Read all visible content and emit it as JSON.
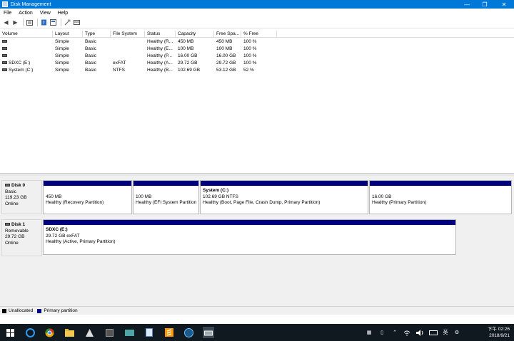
{
  "window": {
    "title": "Disk Management",
    "controls": {
      "minimize": "—",
      "maximize": "❐",
      "close": "✕"
    }
  },
  "menu": [
    "File",
    "Action",
    "View",
    "Help"
  ],
  "toolbar_icons": [
    "back-icon",
    "forward-icon",
    "list-icon",
    "help-icon",
    "properties-icon",
    "connect-icon",
    "disk-view-icon"
  ],
  "volume_table": {
    "columns": [
      "Volume",
      "Layout",
      "Type",
      "File System",
      "Status",
      "Capacity",
      "Free Spa...",
      "% Free"
    ],
    "rows": [
      {
        "volume": "",
        "layout": "Simple",
        "type": "Basic",
        "fs": "",
        "status": "Healthy (R...",
        "capacity": "450 MB",
        "free": "450 MB",
        "pct": "100 %"
      },
      {
        "volume": "",
        "layout": "Simple",
        "type": "Basic",
        "fs": "",
        "status": "Healthy (E...",
        "capacity": "100 MB",
        "free": "100 MB",
        "pct": "100 %"
      },
      {
        "volume": "",
        "layout": "Simple",
        "type": "Basic",
        "fs": "",
        "status": "Healthy (P...",
        "capacity": "16.00 GB",
        "free": "16.00 GB",
        "pct": "100 %"
      },
      {
        "volume": "SDXC (E:)",
        "layout": "Simple",
        "type": "Basic",
        "fs": "exFAT",
        "status": "Healthy (A...",
        "capacity": "29.72 GB",
        "free": "29.72 GB",
        "pct": "100 %"
      },
      {
        "volume": "System (C:)",
        "layout": "Simple",
        "type": "Basic",
        "fs": "NTFS",
        "status": "Healthy (B...",
        "capacity": "102.69 GB",
        "free": "53.12 GB",
        "pct": "52 %"
      }
    ]
  },
  "disks": [
    {
      "name": "Disk 0",
      "type": "Basic",
      "size": "119.23 GB",
      "state": "Online",
      "partitions": [
        {
          "title": "",
          "line1": "450 MB",
          "line2": "Healthy (Recovery Partition)"
        },
        {
          "title": "",
          "line1": "100 MB",
          "line2": "Healthy (EFI System Partition"
        },
        {
          "title": "System  (C:)",
          "line1": "102.69 GB NTFS",
          "line2": "Healthy (Boot, Page File, Crash Dump, Primary Partition)"
        },
        {
          "title": "",
          "line1": "16.00 GB",
          "line2": "Healthy (Primary Partition)"
        }
      ]
    },
    {
      "name": "Disk 1",
      "type": "Removable",
      "size": "29.72 GB",
      "state": "Online",
      "partitions": [
        {
          "title": "SDXC  (E:)",
          "line1": "29.72 GB exFAT",
          "line2": "Healthy (Active, Primary Partition)"
        }
      ]
    }
  ],
  "legend": [
    {
      "label": "Unallocated",
      "color": "#000000"
    },
    {
      "label": "Primary partition",
      "color": "#00007f"
    }
  ],
  "taskbar": {
    "apps": [
      "start-icon",
      "edge-icon",
      "chrome-icon",
      "file-explorer-icon",
      "app-icon",
      "app-icon",
      "app-icon",
      "app-icon",
      "sublime-icon",
      "app-icon",
      "disk-management-icon"
    ],
    "ime": "英",
    "clock_time": "下午 02:26",
    "clock_date": "2018/9/21"
  }
}
